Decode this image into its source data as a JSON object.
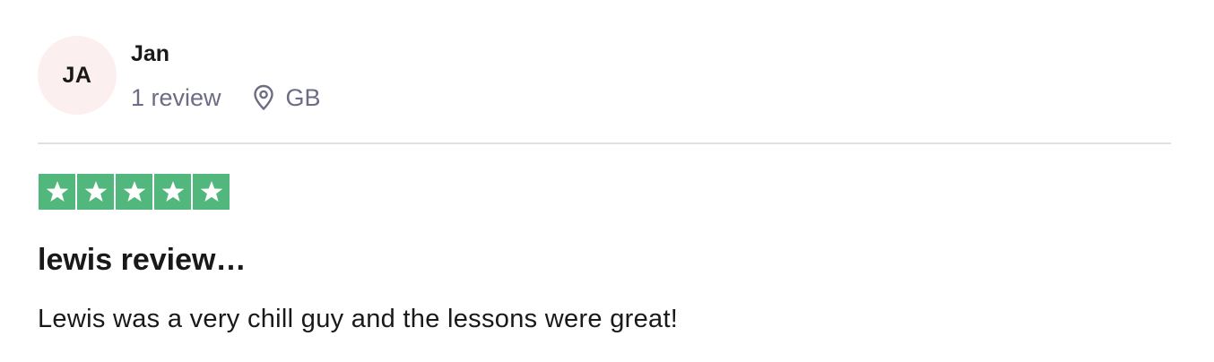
{
  "consumer": {
    "initials": "JA",
    "name": "Jan",
    "review_count": "1 review",
    "country": "GB",
    "avatar_color": "#fcefef"
  },
  "review": {
    "rating": 5,
    "max_rating": 5,
    "star_color": "#52b77d",
    "title": "lewis review…",
    "text": "Lewis was a very chill guy and the lessons were great!"
  },
  "icons": {
    "location": "location-pin-icon",
    "star": "star-icon"
  }
}
